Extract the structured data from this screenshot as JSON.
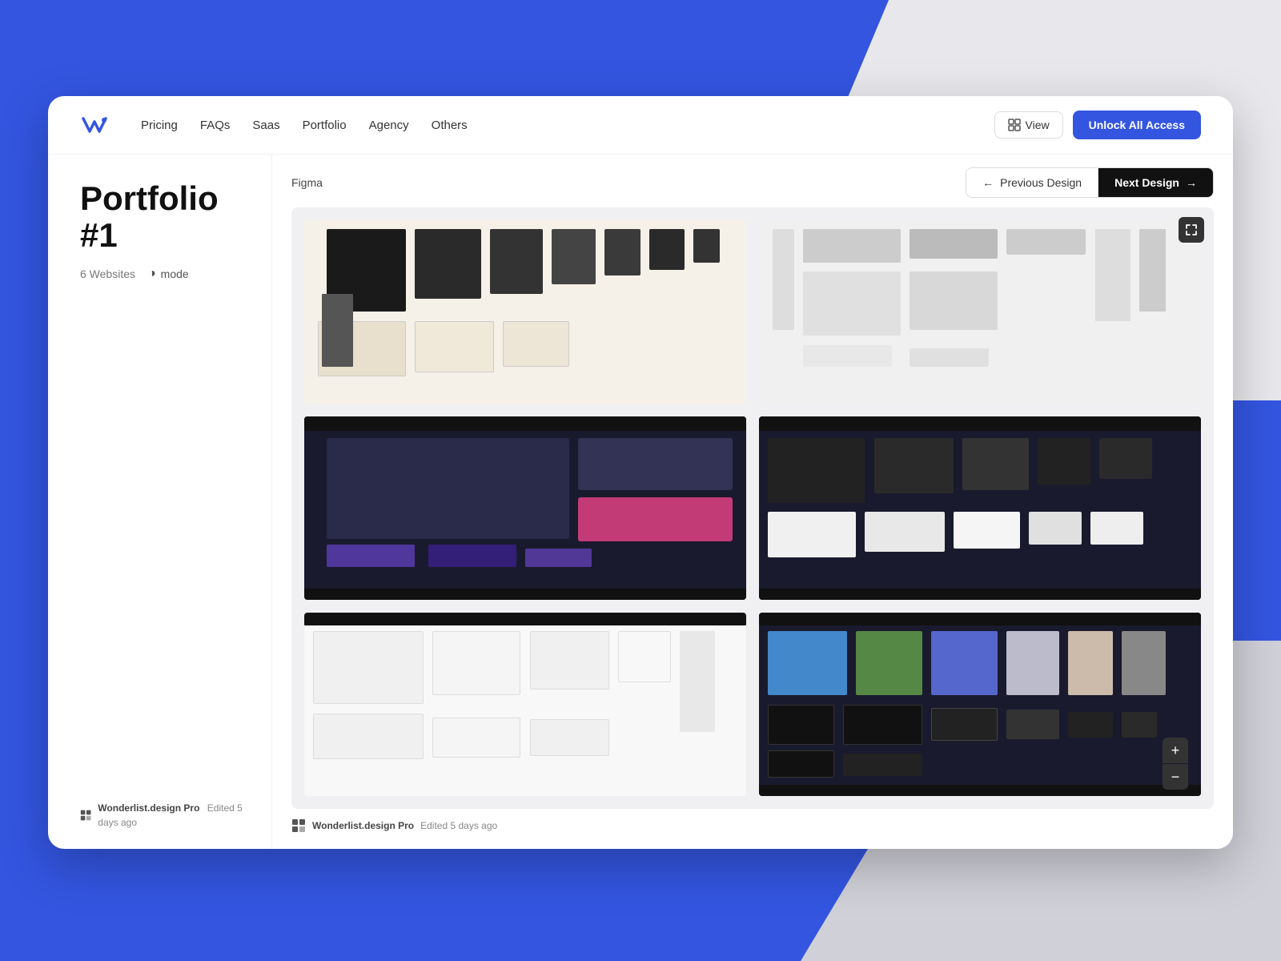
{
  "background": {
    "color": "#3355e0"
  },
  "navbar": {
    "logo_alt": "Wonderlist logo",
    "links": [
      {
        "label": "Pricing",
        "id": "pricing"
      },
      {
        "label": "FAQs",
        "id": "faqs"
      },
      {
        "label": "Saas",
        "id": "saas"
      },
      {
        "label": "Portfolio",
        "id": "portfolio"
      },
      {
        "label": "Agency",
        "id": "agency"
      },
      {
        "label": "Others",
        "id": "others"
      }
    ],
    "view_label": "View",
    "unlock_label": "Unlock All Access"
  },
  "page": {
    "title": "Portfolio #1",
    "website_count": "6 Websites",
    "mode_label": "mode"
  },
  "canvas": {
    "label": "Figma",
    "prev_label": "Previous Design",
    "next_label": "Next Design"
  },
  "footer": {
    "brand": "Wonderlist.design Pro",
    "edit_text": "Edited 5 days ago"
  },
  "zoom": {
    "plus": "+",
    "minus": "−"
  }
}
